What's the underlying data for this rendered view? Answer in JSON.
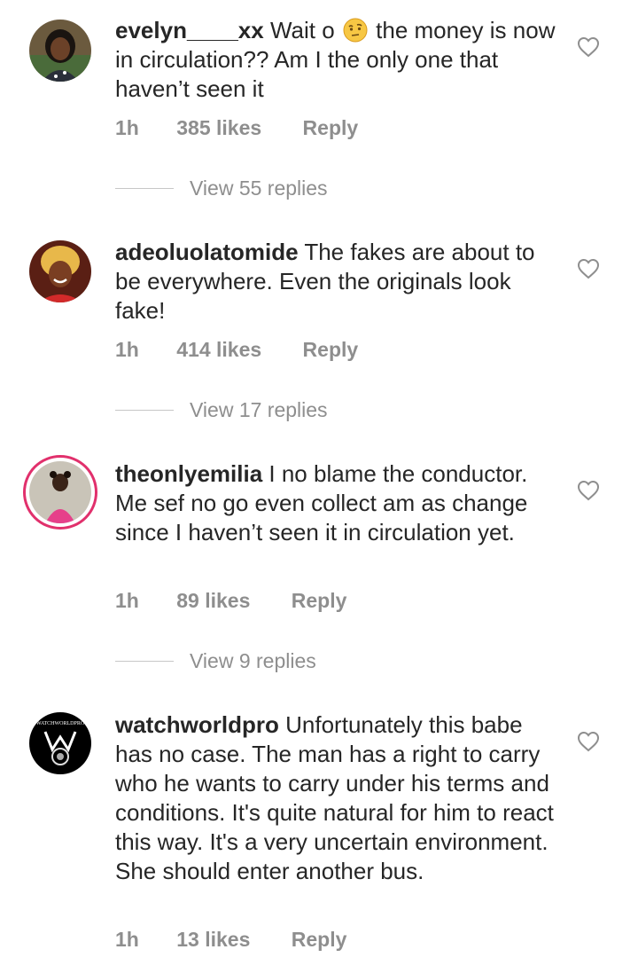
{
  "comments": [
    {
      "username": "evelyn____xx",
      "text_before": "Wait o",
      "emoji": "thinking-face-emoji",
      "text_after": "the money is now in circulation?? Am I the only one that haven’t seen it",
      "time": "1h",
      "likes": "385 likes",
      "reply": "Reply",
      "view_replies": "View 55 replies"
    },
    {
      "username": "adeoluolatomide",
      "text": "The fakes are about to be everywhere. Even the originals look fake!",
      "time": "1h",
      "likes": "414 likes",
      "reply": "Reply",
      "view_replies": "View 17 replies"
    },
    {
      "username": "theonlyemilia",
      "text": "I no blame the conductor. Me sef no go even collect am as change since I haven’t seen it in circulation yet.",
      "time": "1h",
      "likes": "89 likes",
      "reply": "Reply",
      "view_replies": "View 9 replies"
    },
    {
      "username": "watchworldpro",
      "text": "Unfortunately this babe has no case. The man has a right to carry who he wants to carry under his terms and conditions. It's quite natural for him to react this way. It's a very uncertain environment. She should enter another bus.",
      "time": "1h",
      "likes": "13 likes",
      "reply": "Reply",
      "avatar_logo_text": "WATCHWORLDPRO"
    }
  ],
  "colors": {
    "text": "#262626",
    "meta": "#8e8e8e",
    "story_ring": "#e1306c"
  }
}
